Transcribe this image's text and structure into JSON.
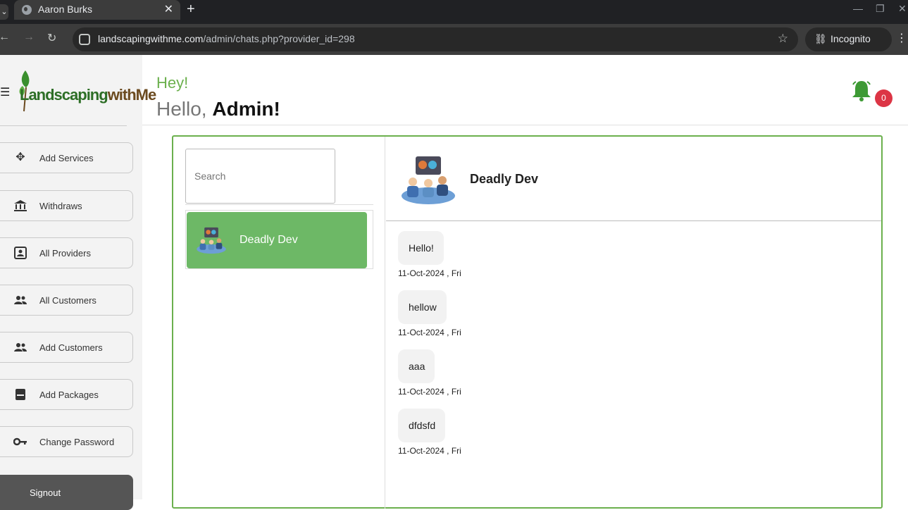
{
  "browser": {
    "tab_title": "Aaron Burks",
    "url_host": "landscapingwithme.com",
    "url_path": "/admin/chats.php?provider_id=298",
    "incognito_label": "Incognito"
  },
  "logo": {
    "part1": "Landscaping",
    "part2": "withMe"
  },
  "sidebar": {
    "items": [
      {
        "label": "Add Services",
        "icon": "move-arrows-icon"
      },
      {
        "label": "Withdraws",
        "icon": "bank-icon"
      },
      {
        "label": "All Providers",
        "icon": "contact-card-icon"
      },
      {
        "label": "All Customers",
        "icon": "people-icon"
      },
      {
        "label": "Add Customers",
        "icon": "people-icon"
      },
      {
        "label": "Add Packages",
        "icon": "package-icon"
      },
      {
        "label": "Change Password",
        "icon": "key-icon"
      }
    ],
    "signout_label": "Signout"
  },
  "header": {
    "greeting": "Hey!",
    "hello": "Hello,",
    "user": "Admin!",
    "notification_count": "0"
  },
  "chat": {
    "search_placeholder": "Search",
    "contacts": [
      {
        "name": "Deadly Dev"
      }
    ],
    "active_contact": "Deadly Dev",
    "messages": [
      {
        "text": "Hello!",
        "time": "11-Oct-2024 , Fri"
      },
      {
        "text": "hellow",
        "time": "11-Oct-2024 , Fri"
      },
      {
        "text": "aaa",
        "time": "11-Oct-2024 , Fri"
      },
      {
        "text": "dfdsfd",
        "time": "11-Oct-2024 , Fri"
      }
    ]
  },
  "colors": {
    "accent": "#6bb04d",
    "contact_bg": "#6db866",
    "badge": "#dc3545"
  }
}
